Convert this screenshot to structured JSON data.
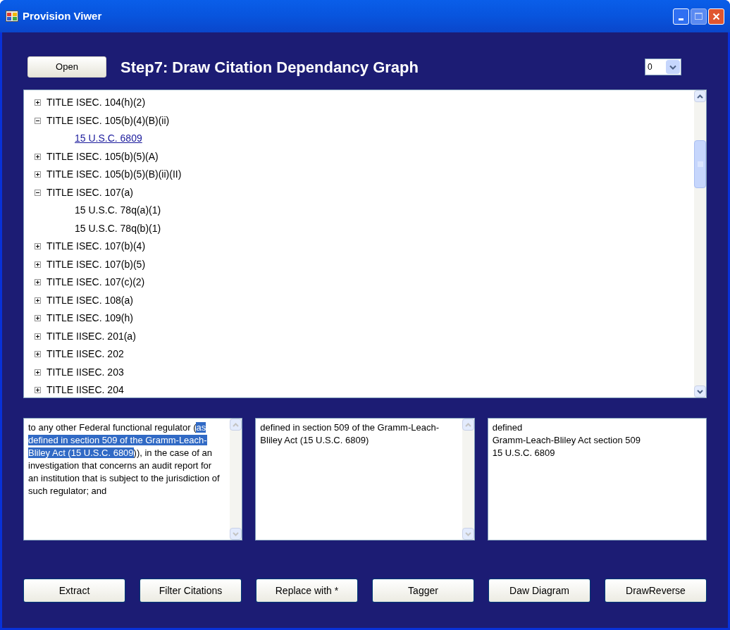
{
  "window": {
    "title": "Provision Viwer"
  },
  "toolbar": {
    "open_button": "Open",
    "heading": "Step7: Draw Citation Dependancy Graph",
    "dropdown": {
      "value": "0"
    }
  },
  "tree": [
    {
      "label": "TITLE ISEC. 104(h)(2)",
      "expanded": false,
      "selected": false
    },
    {
      "label": "TITLE ISEC. 105(b)(4)(B)(ii)",
      "expanded": true,
      "selected": false,
      "children": [
        {
          "label": "15 U.S.C. 6809",
          "selected": true
        }
      ]
    },
    {
      "label": "TITLE ISEC. 105(b)(5)(A)",
      "expanded": false,
      "selected": false
    },
    {
      "label": "TITLE ISEC. 105(b)(5)(B)(ii)(II)",
      "expanded": false,
      "selected": false
    },
    {
      "label": "TITLE ISEC. 107(a)",
      "expanded": true,
      "selected": false,
      "children": [
        {
          "label": "15 U.S.C. 78q(a)(1)",
          "selected": false
        },
        {
          "label": "15 U.S.C. 78q(b)(1)",
          "selected": false
        }
      ]
    },
    {
      "label": "TITLE ISEC. 107(b)(4)",
      "expanded": false,
      "selected": false
    },
    {
      "label": "TITLE ISEC. 107(b)(5)",
      "expanded": false,
      "selected": false
    },
    {
      "label": "TITLE ISEC. 107(c)(2)",
      "expanded": false,
      "selected": false
    },
    {
      "label": "TITLE ISEC. 108(a)",
      "expanded": false,
      "selected": false
    },
    {
      "label": "TITLE ISEC. 109(h)",
      "expanded": false,
      "selected": false
    },
    {
      "label": "TITLE IISEC. 201(a)",
      "expanded": false,
      "selected": false
    },
    {
      "label": "TITLE IISEC. 202",
      "expanded": false,
      "selected": false
    },
    {
      "label": "TITLE IISEC. 203",
      "expanded": false,
      "selected": false
    },
    {
      "label": "TITLE IISEC. 204",
      "expanded": false,
      "selected": false
    }
  ],
  "text_boxes": [
    {
      "has_scrollbar": true,
      "segments": [
        {
          "text": "to any other Federal functional regulator (",
          "selected": false
        },
        {
          "text": "as defined in section 509 of the Gramm-Leach-Bliley Act (15 U.S.C. 6809",
          "selected": true
        },
        {
          "text": ")), in the case of an investigation that concerns an audit report for an institution that is subject to the jurisdiction of such regulator; and",
          "selected": false
        }
      ]
    },
    {
      "has_scrollbar": true,
      "segments": [
        {
          "text": "defined in section 509 of the Gramm-Leach-Bliley Act (15 U.S.C. 6809)",
          "selected": false
        }
      ]
    },
    {
      "has_scrollbar": false,
      "lines": [
        "defined",
        "Gramm-Leach-Bliley Act section 509",
        "15 U.S.C. 6809"
      ]
    }
  ],
  "buttons": [
    "Extract",
    "Filter Citations",
    "Replace with *",
    "Tagger",
    "Daw Diagram",
    "DrawReverse"
  ]
}
